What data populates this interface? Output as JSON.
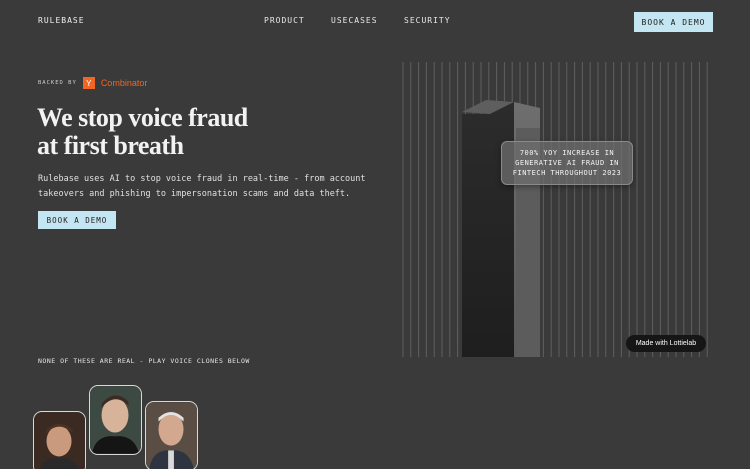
{
  "header": {
    "brand": "RULEBASE",
    "nav": [
      "PRODUCT",
      "USECASES",
      "SECURITY"
    ],
    "cta": "BOOK A DEMO"
  },
  "hero": {
    "backed_by": "BACKED BY",
    "yc_letter": "Y",
    "yc_name": "Combinator",
    "headline_line1": "We stop voice fraud",
    "headline_line2": "at first breath",
    "subtext": "Rulebase uses AI to stop voice fraud in real-time - from account takeovers and phishing to impersonation scams and data theft.",
    "cta": "BOOK A DEMO"
  },
  "visual": {
    "stat": "700% YOY INCREASE IN GENERATIVE AI FRAUD IN FINTECH THROUGHOUT 2023",
    "badge": "Made with Lottielab"
  },
  "clones": {
    "label": "NONE OF THESE ARE REAL - PLAY VOICE CLONES BELOW",
    "avatars": [
      "avatar-1",
      "avatar-2",
      "avatar-3"
    ]
  },
  "colors": {
    "background": "#3a3a3a",
    "accent": "#c4e5f2",
    "yc_orange": "#f26522"
  }
}
